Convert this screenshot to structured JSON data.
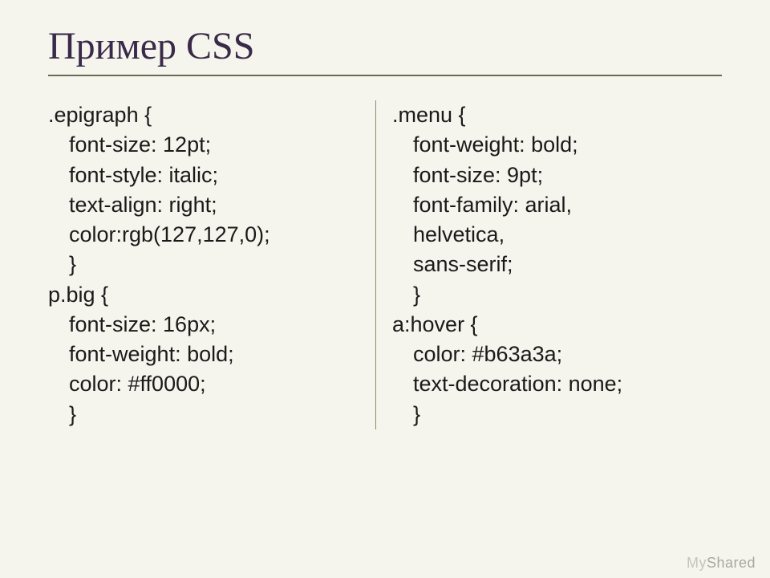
{
  "title": "Пример CSS",
  "left": {
    "l1": ".epigraph {",
    "l2": "font-size: 12pt;",
    "l3": "font-style: italic;",
    "l4": "text-align: right;",
    "l5": "color:rgb(127,127,0);",
    "l6": "}",
    "l7": "p.big {",
    "l8": "font-size: 16px;",
    "l9": "font-weight: bold;",
    "l10": "color: #ff0000;",
    "l11": "}"
  },
  "right": {
    "l1": ".menu {",
    "l2": "font-weight: bold;",
    "l3": "font-size: 9pt;",
    "l4": "font-family: arial,",
    "l5": "helvetica,",
    "l6": "sans-serif;",
    "l7": "}",
    "l8": "a:hover {",
    "l9": "color: #b63a3a;",
    "l10": "text-decoration: none;",
    "l11": "}"
  },
  "watermark": {
    "part1": "My",
    "part2": "Shared"
  }
}
